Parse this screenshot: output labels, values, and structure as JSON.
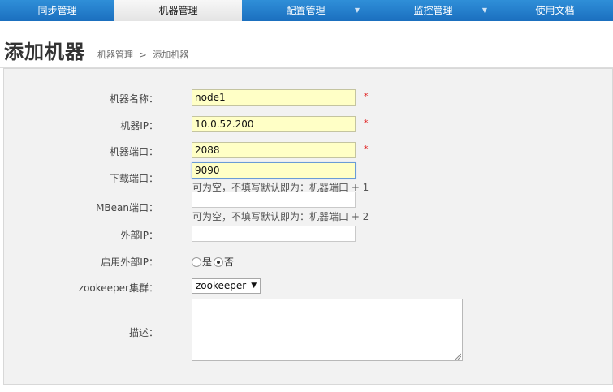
{
  "nav": {
    "items": [
      {
        "label": "同步管理",
        "active": false
      },
      {
        "label": "机器管理",
        "active": true
      },
      {
        "label": "配置管理",
        "active": false,
        "dropdown": true
      },
      {
        "label": "监控管理",
        "active": false,
        "dropdown": true
      },
      {
        "label": "使用文档",
        "active": false
      }
    ]
  },
  "header": {
    "title": "添加机器",
    "breadcrumb": [
      "机器管理",
      ">",
      "添加机器"
    ]
  },
  "form": {
    "machine_name": {
      "label": "机器名称：",
      "value": "node1",
      "required": "*"
    },
    "machine_ip": {
      "label": "机器IP：",
      "value": "10.0.52.200",
      "required": "*"
    },
    "machine_port": {
      "label": "机器端口：",
      "value": "2088",
      "required": "*"
    },
    "download_port": {
      "label": "下载端口：",
      "value": "9090",
      "hint": "可为空，不填写默认即为：机器端口 + 1"
    },
    "mbean_port": {
      "label": "MBean端口：",
      "value": "",
      "hint": "可为空，不填写默认即为：机器端口 + 2"
    },
    "external_ip": {
      "label": "外部IP：",
      "value": ""
    },
    "enable_external_ip": {
      "label": "启用外部IP：",
      "options": [
        "是",
        "否"
      ],
      "selected": "否"
    },
    "zookeeper_cluster": {
      "label": "zookeeper集群：",
      "selected": "zookeeper"
    },
    "description": {
      "label": "描述：",
      "value": ""
    }
  }
}
